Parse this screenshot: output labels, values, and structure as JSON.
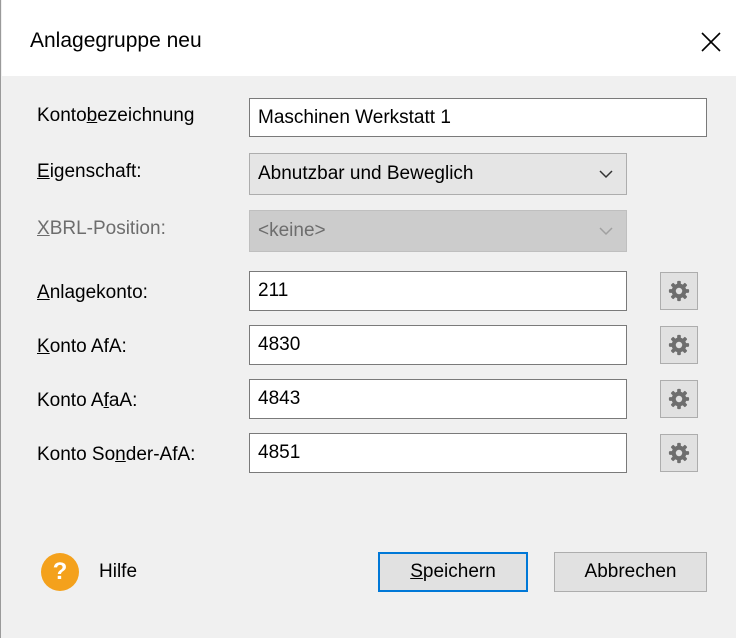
{
  "window": {
    "title": "Anlagegruppe neu"
  },
  "form": {
    "kontobezeichnung": {
      "label_pre": "Konto",
      "label_ul": "b",
      "label_post": "ezeichnung",
      "value": "Maschinen Werkstatt 1"
    },
    "eigenschaft": {
      "label_pre": "",
      "label_ul": "E",
      "label_post": "igenschaft:",
      "value": "Abnutzbar und Beweglich"
    },
    "xbrl_position": {
      "label_pre": "",
      "label_ul": "X",
      "label_post": "BRL-Position:",
      "value": "<keine>"
    },
    "anlagekonto": {
      "label_pre": "",
      "label_ul": "A",
      "label_post": "nlagekonto:",
      "value": "211"
    },
    "konto_afa": {
      "label_pre": "",
      "label_ul": "K",
      "label_post": "onto AfA:",
      "value": "4830"
    },
    "konto_afaa": {
      "label_pre": "Konto A",
      "label_ul": "f",
      "label_post": "aA:",
      "value": "4843"
    },
    "konto_sonder_afa": {
      "label_pre": "Konto So",
      "label_ul": "n",
      "label_post": "der-AfA:",
      "value": "4851"
    }
  },
  "footer": {
    "help_icon_glyph": "?",
    "help_label": "Hilfe",
    "save_pre": "",
    "save_ul": "S",
    "save_post": "peichern",
    "cancel_label": "Abbrechen"
  },
  "colors": {
    "accent": "#0078d7",
    "help_icon": "#f4a11c"
  }
}
